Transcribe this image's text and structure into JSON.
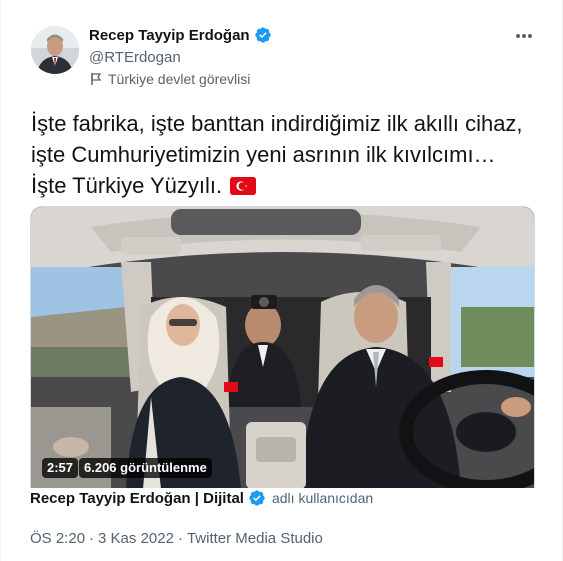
{
  "author": {
    "name": "Recep Tayyip Erdoğan",
    "handle": "@RTErdogan",
    "label": "Türkiye devlet görevlisi"
  },
  "tweet": {
    "text": "İşte fabrika, işte banttan indirdiğimiz ilk akıllı cihaz, işte Cumhuriyetimizin yeni asrının ilk kıvılcımı… İşte Türkiye Yüzyılı."
  },
  "video": {
    "duration": "2:57",
    "views": "6.206 görüntülenme"
  },
  "attribution": {
    "name": "Recep Tayyip Erdoğan | Dijital",
    "suffix": "adlı kullanıcıdan"
  },
  "meta": {
    "time": "ÖS 2:20",
    "separator1": "·",
    "date": "3 Kas 2022",
    "separator2": "·",
    "source": "Twitter Media Studio"
  },
  "colors": {
    "verified": "#1d9bf0",
    "flag": "#e30a17",
    "secondary_text": "#536471"
  },
  "icons": {
    "more": "more-icon",
    "verified": "verified-icon",
    "flag": "turkey-flag-icon",
    "gov": "government-flag-icon"
  }
}
